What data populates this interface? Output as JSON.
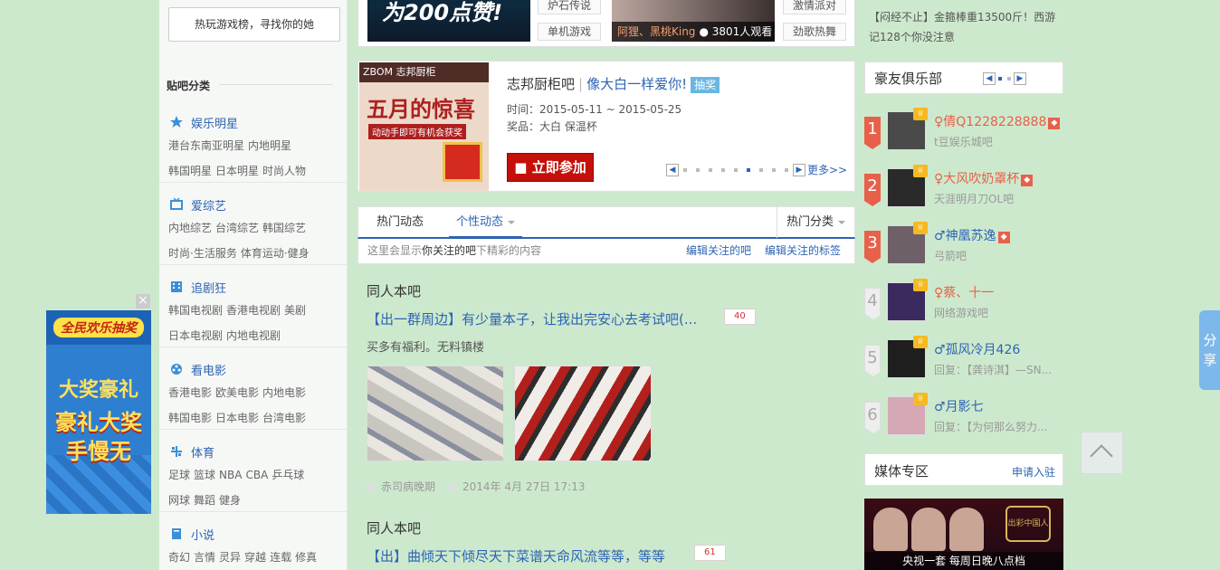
{
  "sidebar": {
    "hot_search": "热玩游戏榜，寻找你的她",
    "category_title": "贴吧分类",
    "categories": [
      {
        "name": "娱乐明星",
        "rows": [
          [
            "港台东南亚明星",
            "内地明星"
          ],
          [
            "韩国明星",
            "日本明星",
            "时尚人物"
          ]
        ]
      },
      {
        "name": "爱综艺",
        "rows": [
          [
            "内地综艺",
            "台湾综艺",
            "韩国综艺"
          ],
          [
            "时尚·生活服务",
            "体育运动·健身"
          ]
        ]
      },
      {
        "name": "追剧狂",
        "rows": [
          [
            "韩国电视剧",
            "香港电视剧",
            "美剧"
          ],
          [
            "日本电视剧",
            "内地电视剧"
          ]
        ]
      },
      {
        "name": "看电影",
        "rows": [
          [
            "香港电影",
            "欧美电影",
            "内地电影"
          ],
          [
            "韩国电影",
            "日本电影",
            "台湾电影"
          ]
        ]
      },
      {
        "name": "体育",
        "rows": [
          [
            "足球",
            "篮球",
            "NBA",
            "CBA",
            "乒乓球"
          ],
          [
            "网球",
            "舞蹈",
            "健身"
          ]
        ]
      },
      {
        "name": "小说",
        "rows": [
          [
            "奇幻",
            "言情",
            "灵异",
            "穿越",
            "连载",
            "修真"
          ]
        ]
      }
    ]
  },
  "float_ad": {
    "top": "全民欢乐抽奖",
    "line1": "大奖豪礼",
    "line2": "豪礼大奖",
    "line3": "手慢无",
    "close": "×"
  },
  "top_strip": {
    "banner_text": "为200点赞!",
    "tags": [
      "炉石传说",
      "单机游戏",
      "激情派对",
      "劲歌热舞"
    ],
    "live_names": "阿狸、黑桃King",
    "live_viewers": "3801人观看"
  },
  "promo": {
    "brand_bar": "ZBOM 志邦厨柜",
    "image_big": "五月的惊喜",
    "image_sub": "动动手即可有机会获奖",
    "forum": "志邦厨柜吧",
    "slogan": "像大白一样爱你!",
    "badge": "抽奖",
    "time_label": "时间：",
    "time": "2015-05-11 ~ 2015-05-25",
    "prize_label": "奖品：",
    "prize": "大白 保温杯",
    "join_button": "立即参加",
    "more": "更多>>",
    "page_count": 9,
    "page_active_index": 5
  },
  "feed_tabs": {
    "tab1": "热门动态",
    "tab2": "个性动态",
    "tab_right": "热门分类",
    "hint_prefix": "这里会显示",
    "hint_bold": "你关注的吧",
    "hint_suffix": "下精彩的内容",
    "edit_forums": "编辑关注的吧",
    "edit_tags": "编辑关注的标签"
  },
  "feed": [
    {
      "forum": "同人本吧",
      "title": "【出一群周边】有少量本子，让我出完安心去考试吧(...",
      "replies": "40",
      "desc": "买多有福利。无料镇楼",
      "author": "赤司病晚期",
      "time": "2014年 4月 27日 17:13"
    },
    {
      "forum": "同人本吧",
      "title": "【出】曲倾天下倾尽天下菜谱天命风流等等，等等",
      "replies": "61"
    }
  ],
  "right": {
    "notice": "【闷经不止】金箍棒重13500斤！西游记128个你没注意",
    "club_title": "豪友俱乐部",
    "ranks": [
      {
        "num": "1",
        "name": "倩Q1228228888",
        "sub": "t豆娱乐城吧",
        "gender": "female",
        "hot": true,
        "avatar": "#4a4a4a"
      },
      {
        "num": "2",
        "name": "大风吹奶罩杯",
        "sub": "天涯明月刀OL吧",
        "gender": "female",
        "hot": true,
        "avatar": "#2a2a2a"
      },
      {
        "num": "3",
        "name": "神凰苏逸",
        "sub": "弓箭吧",
        "gender": "male",
        "hot": true,
        "avatar": "#6d6068"
      },
      {
        "num": "4",
        "name": "蔡、十一",
        "sub": "网络游戏吧",
        "gender": "female",
        "hot": false,
        "avatar": "#3b2a5e"
      },
      {
        "num": "5",
        "name": "孤风冷月426",
        "sub": "回复：【龚诗淇】—SN...",
        "gender": "male",
        "hot": false,
        "avatar": "#1e1e1e"
      },
      {
        "num": "6",
        "name": "月影七",
        "sub": "回复：【为何那么努力...",
        "gender": "male",
        "hot": false,
        "avatar": "#d6a7b4"
      }
    ],
    "media_title": "媒体专区",
    "media_link": "申请入驻",
    "media_caption": "央视一套  每周日晚八点档",
    "media_logo": "出彩中国人"
  },
  "share_label": "分享",
  "colors": {
    "brand_blue": "#2d64b3",
    "accent_red": "#e8604a",
    "page_bg": "#cde9cd"
  }
}
